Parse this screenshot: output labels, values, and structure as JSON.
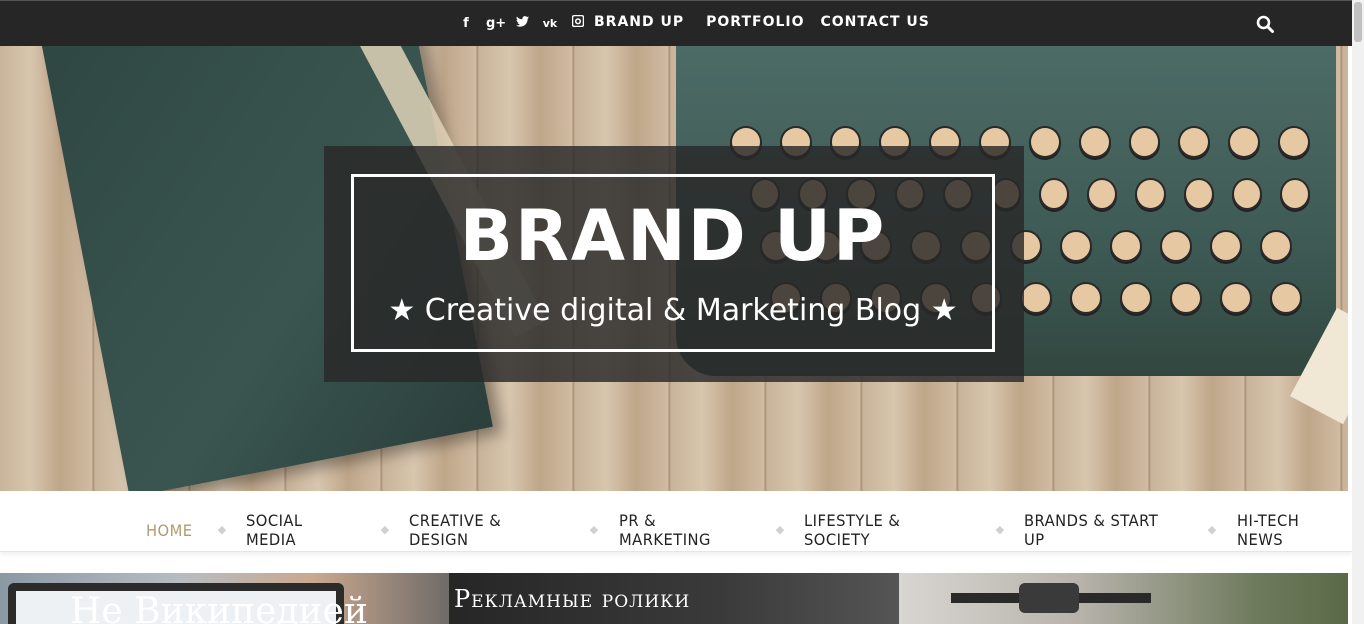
{
  "topbar": {
    "social_icons": [
      {
        "name": "facebook-icon",
        "glyph": "f"
      },
      {
        "name": "google-plus-icon",
        "glyph": "g+"
      },
      {
        "name": "twitter-icon",
        "glyph": "🐦"
      },
      {
        "name": "vk-icon",
        "glyph": "vk"
      },
      {
        "name": "instagram-icon",
        "glyph": "◘"
      }
    ],
    "links": [
      "BRAND UP",
      "PORTFOLIO",
      "CONTACT US"
    ]
  },
  "hero": {
    "title": "BRAND UP",
    "subtitle": "★ Creative digital & Marketing Blog ★"
  },
  "menu": {
    "items": [
      "HOME",
      "SOCIAL MEDIA",
      "CREATIVE & DESIGN",
      "PR & MARKETING",
      "LIFESTYLE & SOCIETY",
      "BRANDS & START UP",
      "HI-TECH NEWS"
    ],
    "active": "HOME",
    "active_color": "#b39a6c"
  },
  "posts": {
    "post1_title": "Не Википедией",
    "post2_title": "Рекламные ролики"
  },
  "colors": {
    "topbar_bg": "#262626",
    "logo_box_bg": "#282828"
  }
}
